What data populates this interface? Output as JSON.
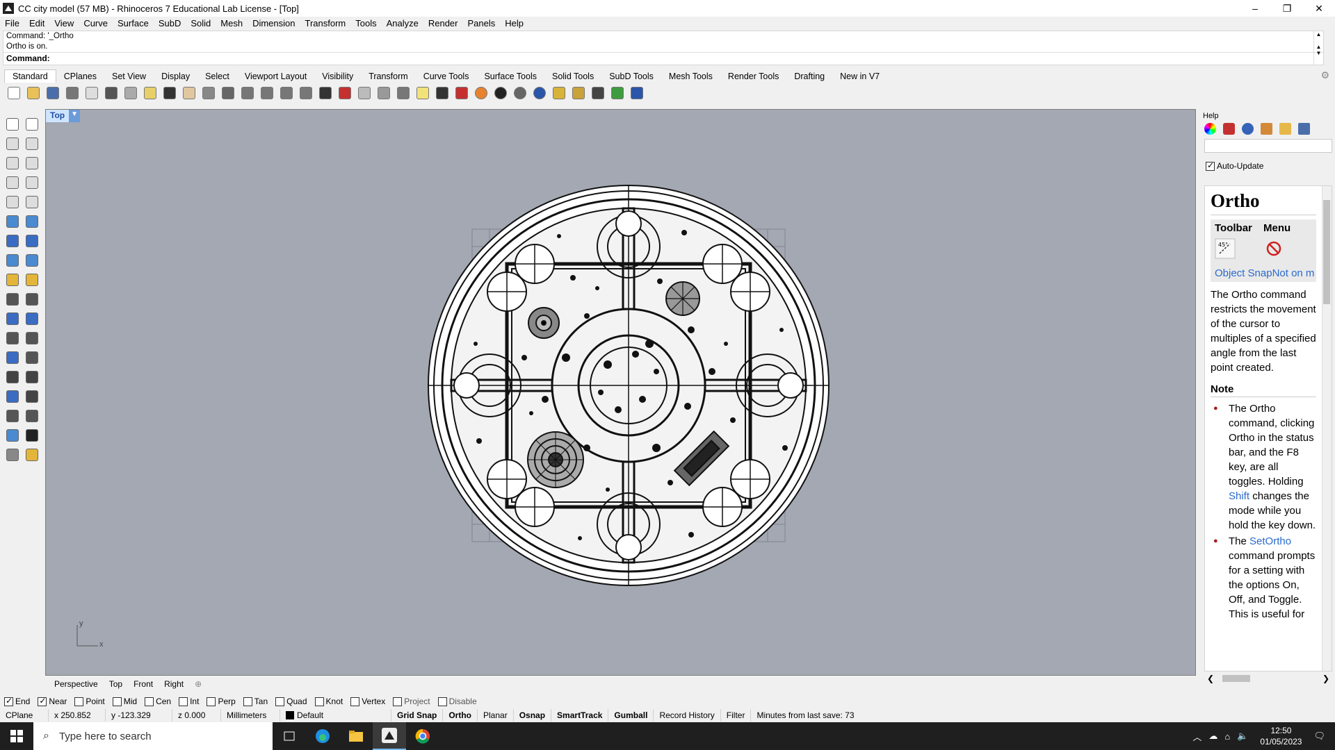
{
  "window": {
    "title": "CC city model (57 MB) - Rhinoceros 7 Educational Lab License - [Top]",
    "controls": [
      "–",
      "❐",
      "✕"
    ]
  },
  "menu": [
    "File",
    "Edit",
    "View",
    "Curve",
    "Surface",
    "SubD",
    "Solid",
    "Mesh",
    "Dimension",
    "Transform",
    "Tools",
    "Analyze",
    "Render",
    "Panels",
    "Help"
  ],
  "command": {
    "history": [
      "Command: '_Ortho",
      "Ortho is on."
    ],
    "prompt_label": "Command:",
    "value": ""
  },
  "toolbar_tabs": [
    "Standard",
    "CPlanes",
    "Set View",
    "Display",
    "Select",
    "Viewport Layout",
    "Visibility",
    "Transform",
    "Curve Tools",
    "Surface Tools",
    "Solid Tools",
    "SubD Tools",
    "Mesh Tools",
    "Render Tools",
    "Drafting",
    "New in V7"
  ],
  "toolbar_icons": [
    "new-icon",
    "open-icon",
    "save-icon",
    "print-icon",
    "import-icon",
    "cut-icon",
    "copy-icon",
    "paste-icon",
    "undo-icon",
    "pan-icon",
    "rotate-icon",
    "zoom-icon",
    "zoom-window-icon",
    "zoom-extents-icon",
    "zoom-selected-icon",
    "zoom-previous-icon",
    "grid-icon",
    "car-icon",
    "plane-icon",
    "circle-icon",
    "light-icon",
    "bulb-icon",
    "lock-icon",
    "material-icon",
    "color-icon",
    "sphere-icon",
    "sphere-shaded-icon",
    "render-icon",
    "flashlight-icon",
    "gear-icon",
    "dimension-icon",
    "globe-icon",
    "help-icon"
  ],
  "viewport": {
    "name": "Top",
    "axis_x": "x",
    "axis_y": "y"
  },
  "viewport_tabs": [
    "Perspective",
    "Top",
    "Front",
    "Right"
  ],
  "osnaps": [
    {
      "label": "End",
      "checked": true
    },
    {
      "label": "Near",
      "checked": true
    },
    {
      "label": "Point",
      "checked": false
    },
    {
      "label": "Mid",
      "checked": false
    },
    {
      "label": "Cen",
      "checked": false
    },
    {
      "label": "Int",
      "checked": false
    },
    {
      "label": "Perp",
      "checked": false
    },
    {
      "label": "Tan",
      "checked": false
    },
    {
      "label": "Quad",
      "checked": false
    },
    {
      "label": "Knot",
      "checked": false
    },
    {
      "label": "Vertex",
      "checked": false
    },
    {
      "label": "Project",
      "checked": false
    },
    {
      "label": "Disable",
      "checked": false
    }
  ],
  "status": {
    "cplane": "CPlane",
    "x": "x 250.852",
    "y": "y -123.329",
    "z": "z 0.000",
    "units": "Millimeters",
    "layer": "Default",
    "grid_snap": "Grid Snap",
    "ortho": "Ortho",
    "planar": "Planar",
    "osnap": "Osnap",
    "smarttrack": "SmartTrack",
    "gumball": "Gumball",
    "record_history": "Record History",
    "filter": "Filter",
    "save_info": "Minutes from last save: 73"
  },
  "help_panel": {
    "title": "Help",
    "auto_update": "Auto-Update",
    "topic": "Ortho",
    "col_toolbar": "Toolbar",
    "col_menu": "Menu",
    "link_toolbar": "Object Snap",
    "link_menu": "Not on m",
    "description": "The Ortho command restricts the movement of the cursor to multiples of a specified angle from the last point created.",
    "note_heading": "Note",
    "note1_a": "The Ortho command, clicking Ortho in the status bar, and the F8 key, are all toggles. Holding",
    "note1_link": "Shift",
    "note1_b": "changes the mode while you hold the key down.",
    "note2_a": "The",
    "note2_link": "SetOrtho",
    "note2_b": "command prompts for a setting with the options On, Off, and Toggle. This is useful for"
  },
  "taskbar": {
    "search_placeholder": "Type here to search",
    "time": "12:50",
    "date": "01/05/2023"
  }
}
